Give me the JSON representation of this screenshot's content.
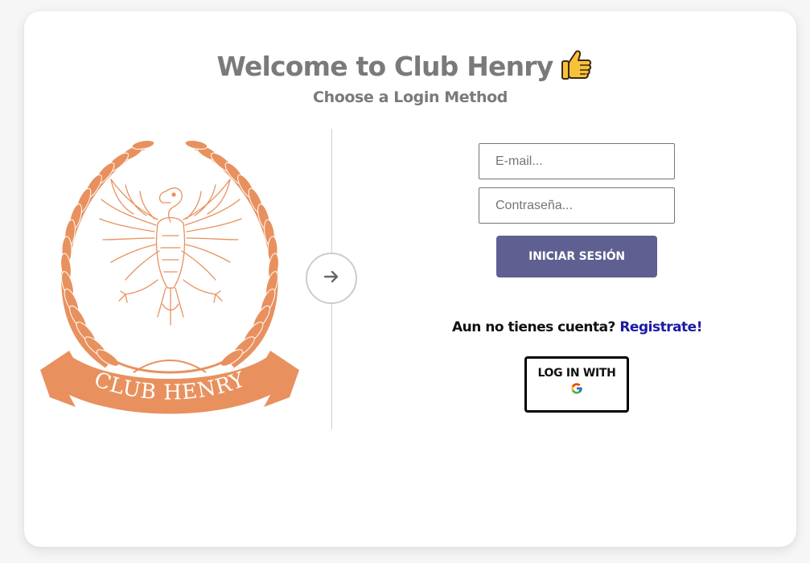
{
  "header": {
    "title": "Welcome to Club Henry",
    "title_emoji": "👍",
    "subtitle": "Choose a Login Method"
  },
  "logo": {
    "text": "CLUB HENRY",
    "color": "#e8915e"
  },
  "form": {
    "email_placeholder": "E-mail...",
    "password_placeholder": "Contraseña...",
    "submit_label": "INICIAR SESIÓN"
  },
  "register": {
    "prompt": "Aun no tienes cuenta?",
    "link_label": "Registrate!"
  },
  "google_login": {
    "label": "LOG IN WITH",
    "icon": "google-icon"
  },
  "colors": {
    "accent": "#5f5f91",
    "link": "#1a1aa6",
    "logo": "#e8915e",
    "title": "#7a7a7a"
  }
}
